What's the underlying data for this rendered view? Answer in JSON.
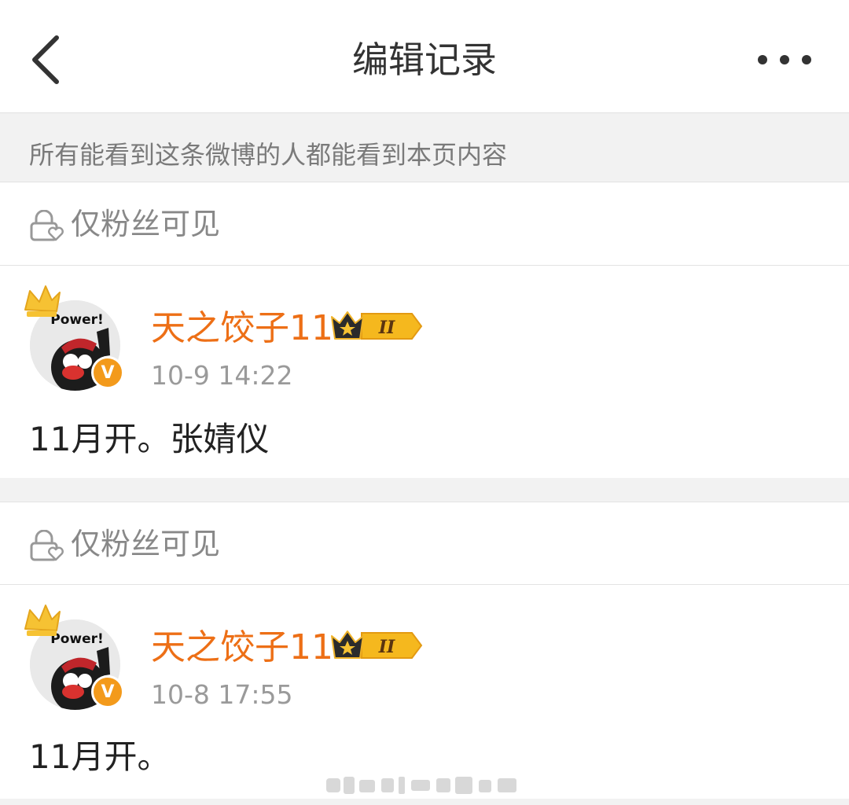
{
  "header": {
    "title": "编辑记录"
  },
  "notice": {
    "text": "所有能看到这条微博的人都能看到本页内容"
  },
  "records": [
    {
      "visibility": "仅粉丝可见",
      "username": "天之饺子11",
      "level": "II",
      "avatar_text": "Power!",
      "verified_mark": "V",
      "time": "10-9 14:22",
      "content": "11月开。张婧仪"
    },
    {
      "visibility": "仅粉丝可见",
      "username": "天之饺子11",
      "level": "II",
      "avatar_text": "Power!",
      "verified_mark": "V",
      "time": "10-8 17:55",
      "content": "11月开。"
    }
  ],
  "colors": {
    "username": "#ed6f16",
    "badge_gold": "#f5b81e",
    "crown_dark": "#2b2b2b",
    "verified": "#f39a1b"
  },
  "icons": [
    "back-arrow-icon",
    "more-dots-icon",
    "lock-heart-icon",
    "crown-icon",
    "verified-icon"
  ]
}
